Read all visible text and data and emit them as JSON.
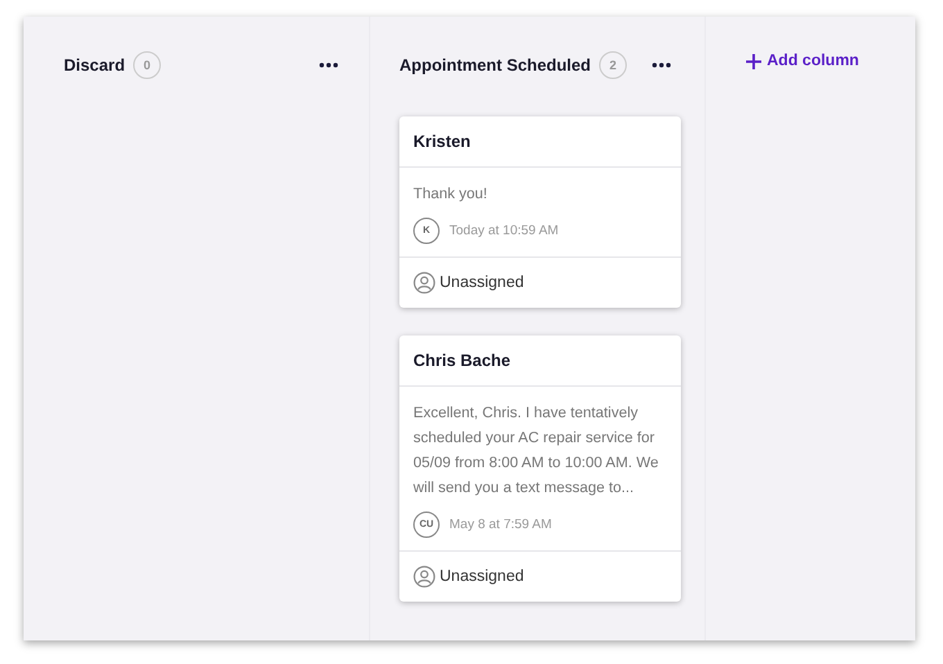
{
  "columns": [
    {
      "title": "Discard",
      "count": "0"
    },
    {
      "title": "Appointment Scheduled",
      "count": "2",
      "cards": [
        {
          "name": "Kristen",
          "message": "Thank you!",
          "initials": "K",
          "time": "Today at 10:59 AM",
          "assignee": "Unassigned"
        },
        {
          "name": "Chris Bache",
          "message": "Excellent, Chris. I have tentatively scheduled your AC repair service for 05/09 from 8:00 AM to 10:00 AM. We will send you a text message to...",
          "initials": "CU",
          "time": "May 8 at 7:59 AM",
          "assignee": "Unassigned"
        }
      ]
    }
  ],
  "add_column": {
    "label": "Add column"
  }
}
